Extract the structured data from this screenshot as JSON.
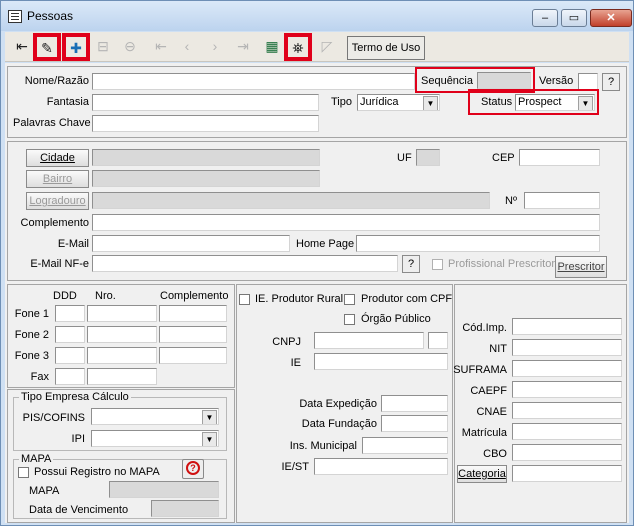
{
  "window": {
    "title": "Pessoas",
    "minimize": "–",
    "maximize": "▭",
    "close": "✕"
  },
  "toolbar": {
    "termo_de_uso": "Termo de Uso"
  },
  "form": {
    "nome_razao_label": "Nome/Razão",
    "fantasia_label": "Fantasia",
    "palavras_chave_label": "Palavras Chave",
    "sequencia_label": "Sequência",
    "versao_label": "Versão",
    "versao_btn": "?",
    "tipo_label": "Tipo",
    "tipo_value": "Jurídica",
    "status_label": "Status",
    "status_value": "Prospect",
    "cidade_btn": "Cidade",
    "bairro_btn": "Bairro",
    "logradouro_btn": "Logradouro",
    "uf_label": "UF",
    "cep_label": "CEP",
    "numero_label": "Nº",
    "complemento_label": "Complemento",
    "email_label": "E-Mail",
    "home_page_label": "Home Page",
    "email_nfe_label": "E-Mail NF-e",
    "email_nfe_btn": "?",
    "profissional_prescritor_label": "Profissional Prescritor",
    "prescritor_btn": "Prescritor"
  },
  "phones": {
    "ddd_header": "DDD",
    "nro_header": "Nro.",
    "complemento_header": "Complemento",
    "rows": [
      "Fone 1",
      "Fone 2",
      "Fone 3",
      "Fax"
    ]
  },
  "tipo_empresa": {
    "title": "Tipo Empresa Cálculo",
    "pis_cofins_label": "PIS/COFINS",
    "ipi_label": "IPI"
  },
  "mapa": {
    "title": "MAPA",
    "possui_registro_label": "Possui Registro no MAPA",
    "help_btn": "?",
    "mapa_label": "MAPA",
    "data_vencimento_label": "Data de Vencimento"
  },
  "fiscal": {
    "ie_produtor_rural_label": "IE. Produtor Rural",
    "produtor_cpf_label": "Produtor com CPF",
    "orgao_publico_label": "Órgão Público",
    "cnpj_label": "CNPJ",
    "ie_label": "IE",
    "data_expedicao_label": "Data Expedição",
    "data_fundacao_label": "Data Fundação",
    "ins_municipal_label": "Ins. Municipal",
    "ie_st_label": "IE/ST"
  },
  "codes": {
    "cod_imp_label": "Cód.Imp.",
    "nit_label": "NIT",
    "suframa_label": "SUFRAMA",
    "caepf_label": "CAEPF",
    "cnae_label": "CNAE",
    "matricula_label": "Matrícula",
    "cbo_label": "CBO",
    "categoria_btn": "Categoria"
  }
}
